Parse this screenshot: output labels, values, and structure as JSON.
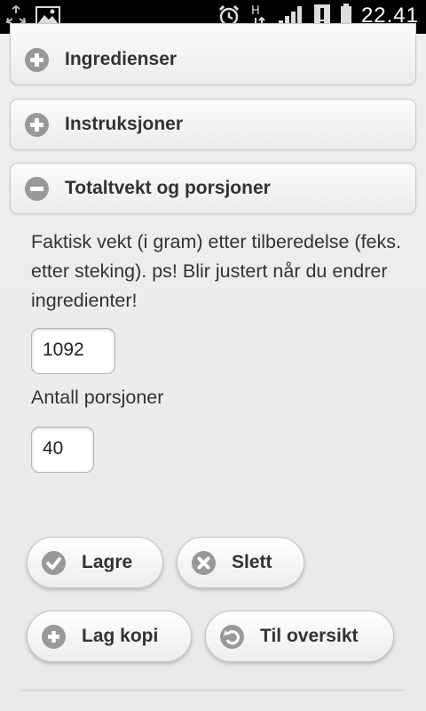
{
  "status_bar": {
    "time": "22.41",
    "icons": [
      "recycle-icon",
      "image-icon",
      "alarm-icon",
      "hsdpa-icon",
      "signal-icon",
      "warning-icon",
      "battery-icon"
    ],
    "network_label": "H"
  },
  "sections": [
    {
      "title": "Ingredienser",
      "expanded": false,
      "icon": "plus-icon"
    },
    {
      "title": "Instruksjoner",
      "expanded": false,
      "icon": "plus-icon"
    },
    {
      "title": "Totaltvekt og porsjoner",
      "expanded": true,
      "icon": "minus-icon"
    }
  ],
  "weight": {
    "description": "Faktisk vekt (i gram) etter tilberedelse (feks. etter steking). ps! Blir justert når du endrer ingredienter!",
    "value": "1092"
  },
  "portions": {
    "label": "Antall porsjoner",
    "value": "40"
  },
  "buttons": {
    "save": "Lagre",
    "delete": "Slett",
    "copy": "Lag kopi",
    "overview": "Til oversikt"
  },
  "colors": {
    "background": "#eeeeee",
    "icon_gray": "#999999",
    "text": "#333333",
    "status_bar": "#000000"
  }
}
